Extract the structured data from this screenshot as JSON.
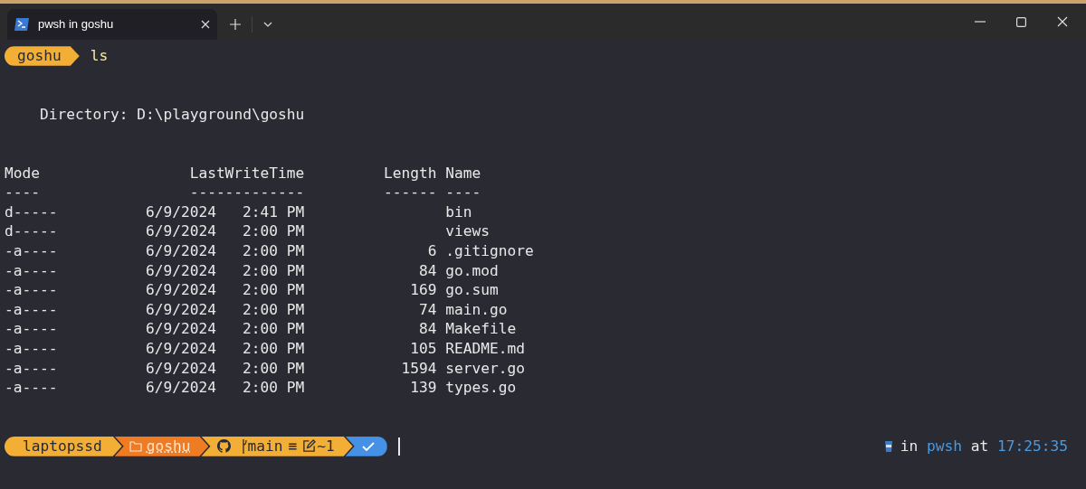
{
  "tabs": [
    {
      "title": "pwsh in goshu",
      "selected": true
    }
  ],
  "prompt": {
    "folder": "goshu",
    "command": "ls"
  },
  "directory": "    Directory: D:\\playground\\goshu",
  "columns": {
    "mode": "Mode",
    "last_write_time": "LastWriteTime",
    "length": "Length",
    "name": "Name"
  },
  "underlines": {
    "mode": "----",
    "last_write_time": "-------------",
    "length": "------",
    "name": "----"
  },
  "rows": [
    {
      "mode": "d-----",
      "date": "6/9/2024",
      "time": "2:41 PM",
      "length": "",
      "name": "bin"
    },
    {
      "mode": "d-----",
      "date": "6/9/2024",
      "time": "2:00 PM",
      "length": "",
      "name": "views"
    },
    {
      "mode": "-a----",
      "date": "6/9/2024",
      "time": "2:00 PM",
      "length": "6",
      "name": ".gitignore"
    },
    {
      "mode": "-a----",
      "date": "6/9/2024",
      "time": "2:00 PM",
      "length": "84",
      "name": "go.mod"
    },
    {
      "mode": "-a----",
      "date": "6/9/2024",
      "time": "2:00 PM",
      "length": "169",
      "name": "go.sum"
    },
    {
      "mode": "-a----",
      "date": "6/9/2024",
      "time": "2:00 PM",
      "length": "74",
      "name": "main.go"
    },
    {
      "mode": "-a----",
      "date": "6/9/2024",
      "time": "2:00 PM",
      "length": "84",
      "name": "Makefile"
    },
    {
      "mode": "-a----",
      "date": "6/9/2024",
      "time": "2:00 PM",
      "length": "105",
      "name": "README.md"
    },
    {
      "mode": "-a----",
      "date": "6/9/2024",
      "time": "2:00 PM",
      "length": "1594",
      "name": "server.go"
    },
    {
      "mode": "-a----",
      "date": "6/9/2024",
      "time": "2:00 PM",
      "length": "139",
      "name": "types.go"
    }
  ],
  "status_prompt": {
    "host": "laptopssd",
    "folder": "goshu",
    "branch": "main",
    "ahead": "≡",
    "changes": "~1"
  },
  "right_prompt": {
    "in": "in",
    "shell": "pwsh",
    "at": "at",
    "time": "17:25:35"
  }
}
